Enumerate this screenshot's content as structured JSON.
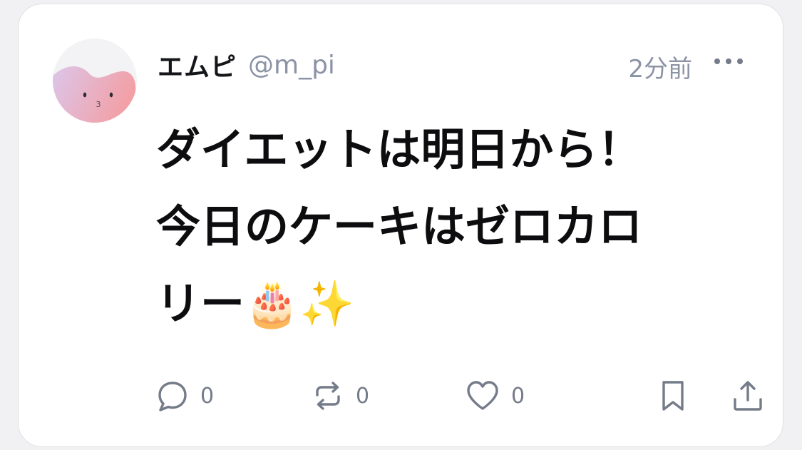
{
  "post": {
    "author": {
      "name": "エムピ",
      "handle": "@m_pi"
    },
    "time": "2分前",
    "text": "ダイエットは明日から！\n今日のケーキはゼロカロ\nリー🎂✨"
  },
  "actions": {
    "reply_count": "0",
    "repost_count": "0",
    "like_count": "0"
  },
  "icons": {
    "avatar": "pink-blob-face-avatar",
    "more": "more-horizontal-icon",
    "reply": "speech-bubble-icon",
    "repost": "repost-arrows-icon",
    "like": "heart-icon",
    "bookmark": "bookmark-icon",
    "share": "share-upload-icon"
  },
  "colors": {
    "text_primary": "#15161a",
    "text_secondary": "#8b93a5",
    "icon": "#747b89",
    "card_border": "#e0e0e4"
  }
}
